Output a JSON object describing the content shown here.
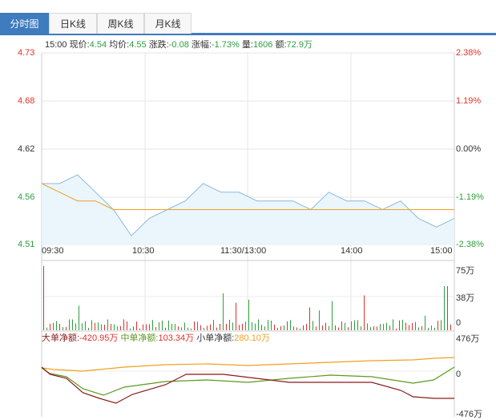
{
  "tabs": [
    {
      "label": "分时图",
      "active": true
    },
    {
      "label": "日K线",
      "active": false
    },
    {
      "label": "周K线",
      "active": false
    },
    {
      "label": "月K线",
      "active": false
    }
  ],
  "info": {
    "time": "15:00",
    "price_label": "现价:",
    "price": "4.54",
    "avg_label": "均价:",
    "avg": "4.55",
    "change_label": "涨跌:",
    "change": "-0.08",
    "pct_label": "涨幅:",
    "pct": "-1.73%",
    "vol_label": "量:",
    "vol": "1606",
    "amt_label": "额:",
    "amt": "72.9万"
  },
  "price_axis": [
    "4.73",
    "4.68",
    "4.62",
    "4.56",
    "4.51"
  ],
  "pct_axis": [
    "2.38%",
    "1.19%",
    "0.00%",
    "-1.19%",
    "-2.38%"
  ],
  "time_axis": [
    "09:30",
    "10:30",
    "11:30/13:00",
    "14:00",
    "15:00"
  ],
  "volume_axis": [
    "75万",
    "38万",
    "0"
  ],
  "flow_axis": [
    "476万",
    "0",
    "-476万"
  ],
  "flow": {
    "big_label": "大单净额:",
    "big": "-420.95万",
    "mid_label": "中单净额:",
    "mid": "103.34万",
    "small_label": "小单净额:",
    "small": "280.10万"
  },
  "colors": {
    "up": "#e0312b",
    "down": "#2e9e3e",
    "avg_line": "#f0a020",
    "price_line": "#8ab9dc",
    "tab_active": "#3f7bbf",
    "big": "#8b1a1a",
    "mid": "#5c9a1e",
    "small": "#f0a020"
  },
  "chart_data": {
    "type": "line",
    "title": "",
    "x": [
      "09:30",
      "10:30",
      "11:30/13:00",
      "14:00",
      "15:00"
    ],
    "ylim": [
      4.51,
      4.73
    ],
    "prev_close": 4.62,
    "series": [
      {
        "values": [
          4.58,
          4.58,
          4.59,
          4.57,
          4.55,
          4.52,
          4.54,
          4.55,
          4.56,
          4.58,
          4.57,
          4.57,
          4.56,
          4.56,
          4.56,
          4.55,
          4.57,
          4.56,
          4.56,
          4.55,
          4.56,
          4.54,
          4.53,
          4.54
        ]
      },
      {
        "values": [
          4.58,
          4.57,
          4.56,
          4.56,
          4.55,
          4.55,
          4.55,
          4.55,
          4.55,
          4.55,
          4.55,
          4.55,
          4.55,
          4.55,
          4.55,
          4.55,
          4.55,
          4.55,
          4.55,
          4.55,
          4.55,
          4.55,
          4.55,
          4.55
        ]
      }
    ]
  }
}
